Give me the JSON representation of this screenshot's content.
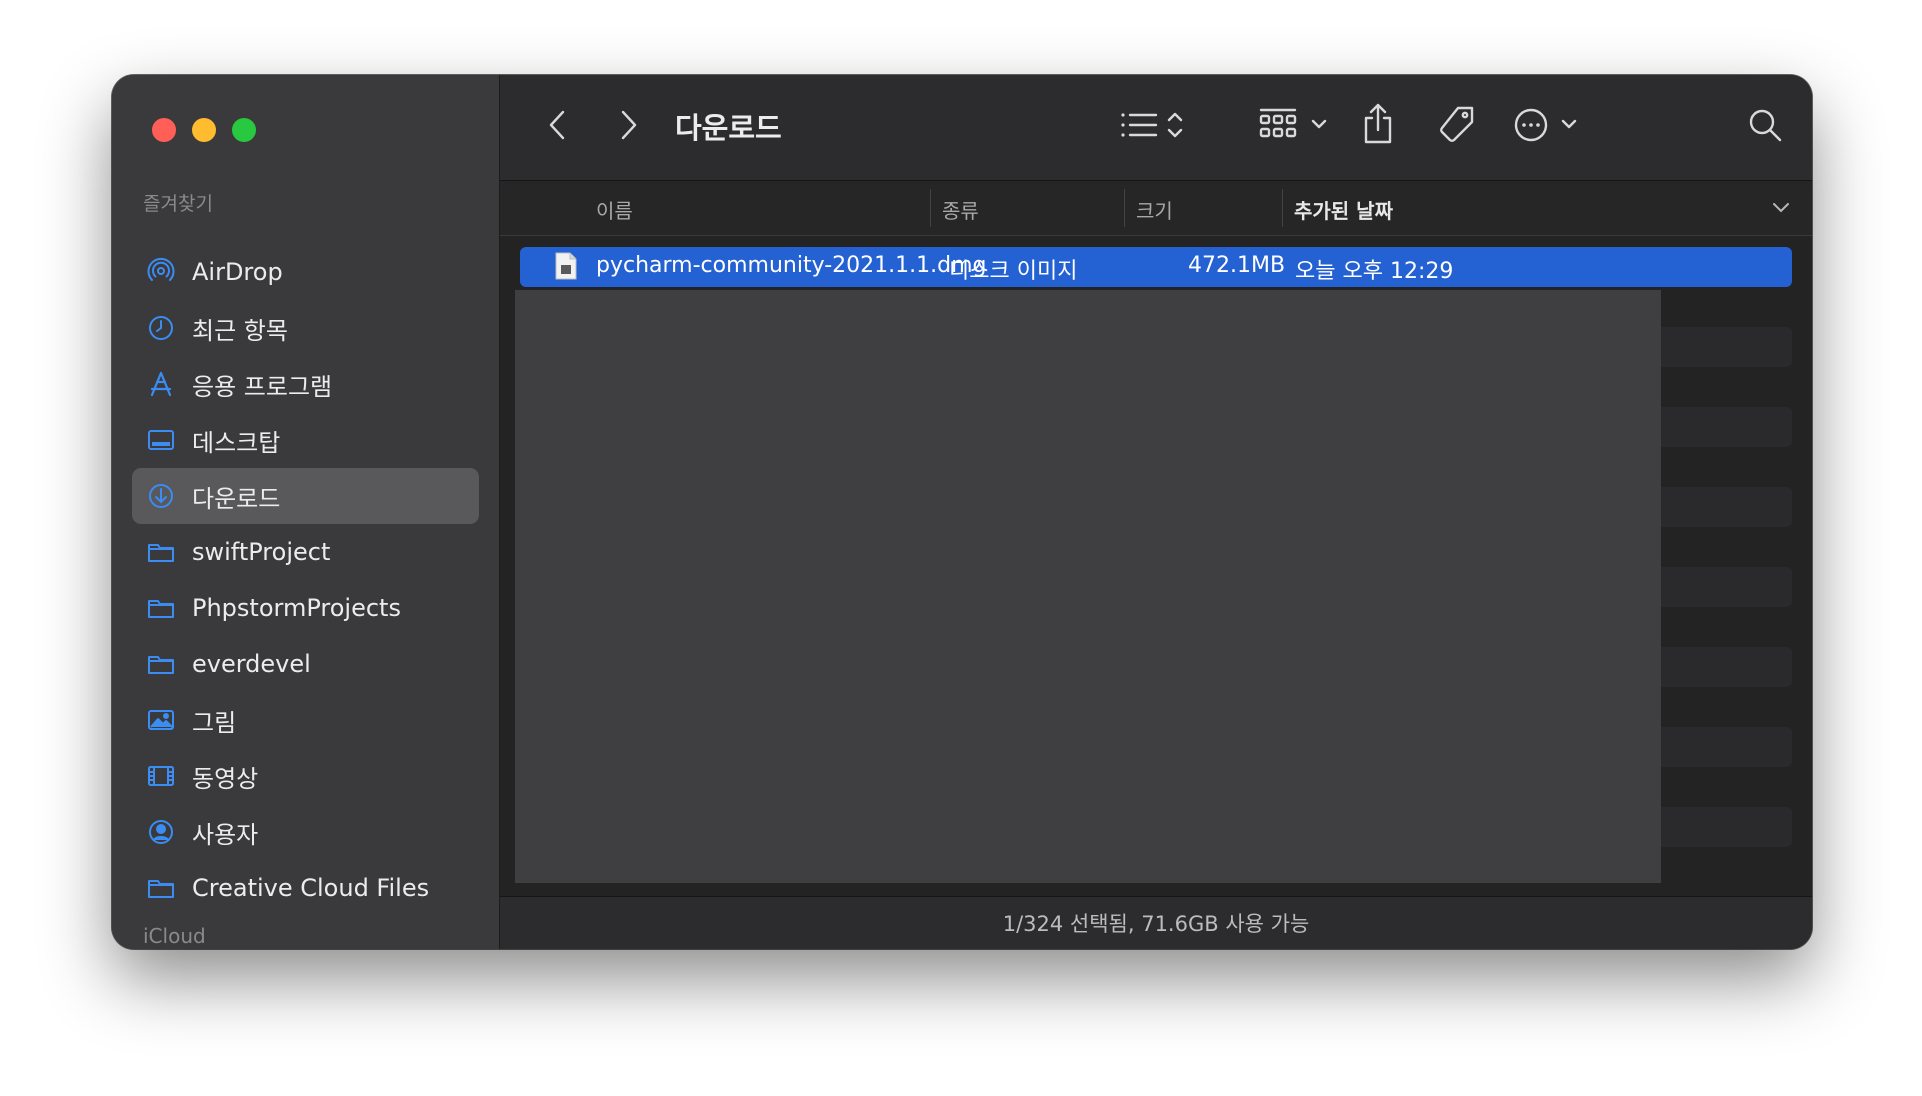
{
  "sidebar": {
    "favorites_label": "즐겨찾기",
    "icloud_label": "iCloud",
    "items": [
      {
        "label": "AirDrop",
        "icon": "airdrop-icon"
      },
      {
        "label": "최근 항목",
        "icon": "clock-icon"
      },
      {
        "label": "응용 프로그램",
        "icon": "applications-icon"
      },
      {
        "label": "데스크탑",
        "icon": "desktop-icon"
      },
      {
        "label": "다운로드",
        "icon": "download-icon",
        "selected": true
      },
      {
        "label": "swiftProject",
        "icon": "folder-icon"
      },
      {
        "label": "PhpstormProjects",
        "icon": "folder-icon"
      },
      {
        "label": "everdevel",
        "icon": "folder-icon"
      },
      {
        "label": "그림",
        "icon": "photo-icon"
      },
      {
        "label": "동영상",
        "icon": "film-icon"
      },
      {
        "label": "사용자",
        "icon": "user-icon"
      },
      {
        "label": "Creative Cloud Files",
        "icon": "folder-icon"
      }
    ]
  },
  "toolbar": {
    "title": "다운로드"
  },
  "columns": {
    "name": "이름",
    "kind": "종류",
    "size": "크기",
    "date_added": "추가된 날짜"
  },
  "files": [
    {
      "name": "pycharm-community-2021.1.1.dmg",
      "kind": "디스크 이미지",
      "size": "472.1MB",
      "date_added": "오늘 오후 12:29",
      "selected": true
    }
  ],
  "status": {
    "text": "1/324 선택됨, 71.6GB 사용 가능"
  },
  "colors": {
    "accent": "#2461d3",
    "sidebar_icon": "#3b8cf3"
  }
}
